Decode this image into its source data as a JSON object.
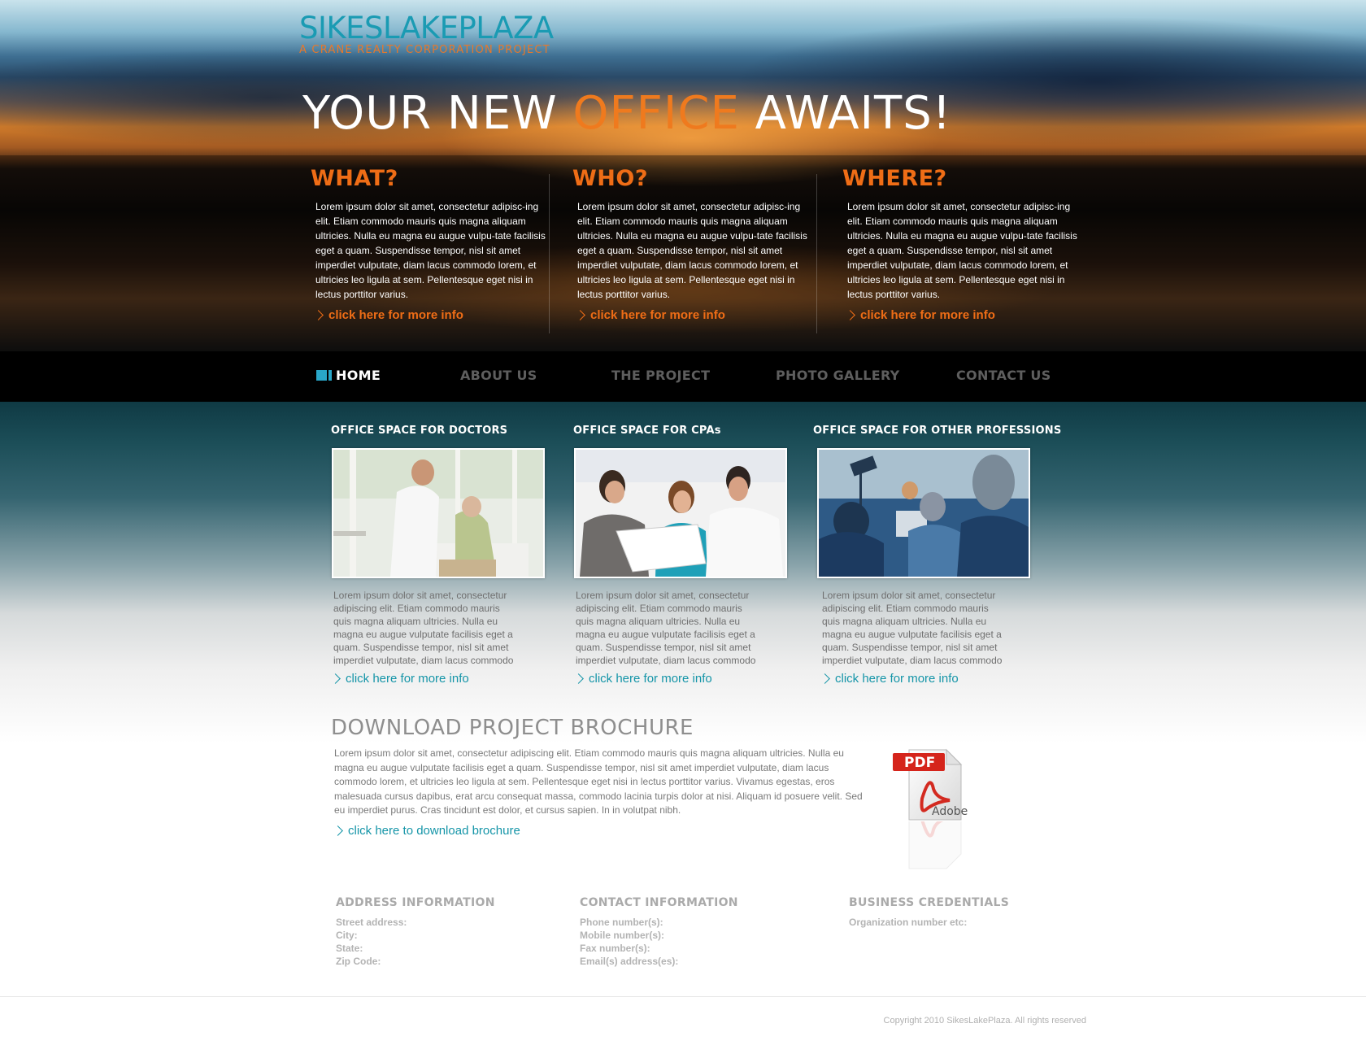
{
  "brand": {
    "name": "SIKESLAKEPLAZA",
    "tagline": "A CRANE REALTY CORPORATION PROJECT",
    "colors": {
      "teal": "#1a9bb3",
      "orange": "#ef6d16"
    }
  },
  "hero": {
    "headline_pre": "YOUR NEW ",
    "headline_accent": "OFFICE",
    "headline_post": " AWAITS!",
    "columns": [
      {
        "title": "WHAT?",
        "text": "Lorem ipsum dolor sit amet, consectetur adipisc-ing elit. Etiam commodo mauris quis magna aliquam ultricies. Nulla eu magna eu augue vulpu-tate facilisis eget a quam. Suspendisse tempor, nisl sit amet imperdiet vulputate, diam lacus commodo lorem, et ultricies leo ligula at sem. Pellentesque eget nisi in lectus porttitor varius.",
        "link": "click here for more info"
      },
      {
        "title": "WHO?",
        "text": "Lorem ipsum dolor sit amet, consectetur adipisc-ing elit. Etiam commodo mauris quis magna aliquam ultricies. Nulla eu magna eu augue vulpu-tate facilisis eget a quam. Suspendisse tempor, nisl sit amet imperdiet vulputate, diam lacus commodo lorem, et ultricies leo ligula at sem. Pellentesque eget nisi in lectus porttitor varius.",
        "link": "click here for more info"
      },
      {
        "title": "WHERE?",
        "text": "Lorem ipsum dolor sit amet, consectetur adipisc-ing elit. Etiam commodo mauris quis magna aliquam ultricies. Nulla eu magna eu augue vulpu-tate facilisis eget a quam. Suspendisse tempor, nisl sit amet imperdiet vulputate, diam lacus commodo lorem, et ultricies leo ligula at sem. Pellentesque eget nisi in lectus porttitor varius.",
        "link": "click here for more info"
      }
    ]
  },
  "nav": {
    "items": [
      {
        "label": "HOME",
        "active": true
      },
      {
        "label": "ABOUT US"
      },
      {
        "label": "THE PROJECT"
      },
      {
        "label": "PHOTO GALLERY"
      },
      {
        "label": "CONTACT US"
      }
    ]
  },
  "services": [
    {
      "title": "OFFICE SPACE FOR DOCTORS",
      "text": "Lorem ipsum dolor sit amet, consectetur adipiscing elit. Etiam commodo mauris quis magna aliquam ultricies. Nulla eu magna eu augue vulputate facilisis eget a quam. Suspendisse tempor, nisl sit amet imperdiet vulputate, diam lacus commodo",
      "link": "click here for more info"
    },
    {
      "title": "OFFICE SPACE FOR CPAs",
      "text": "Lorem ipsum dolor sit amet, consectetur adipiscing elit. Etiam commodo mauris quis magna aliquam ultricies. Nulla eu magna eu augue vulputate facilisis eget a quam. Suspendisse tempor, nisl sit amet imperdiet vulputate, diam lacus commodo",
      "link": "click here for more info"
    },
    {
      "title": "OFFICE SPACE FOR OTHER PROFESSIONS",
      "text": "Lorem ipsum dolor sit amet, consectetur adipiscing elit. Etiam commodo mauris quis magna aliquam ultricies. Nulla eu magna eu augue vulputate facilisis eget a quam. Suspendisse tempor, nisl sit amet imperdiet vulputate, diam lacus commodo",
      "link": "click here for more info"
    }
  ],
  "brochure": {
    "title": "DOWNLOAD PROJECT BROCHURE",
    "text": "Lorem ipsum dolor sit amet, consectetur adipiscing elit. Etiam commodo mauris quis magna aliquam ultricies. Nulla eu magna eu augue vulputate facilisis eget a quam. Suspendisse tempor, nisl sit amet imperdiet vulputate, diam lacus commodo lorem, et ultricies leo ligula at sem. Pellentesque eget nisi in lectus porttitor varius. Vivamus egestas, eros malesuada cursus dapibus, erat arcu consequat massa, commodo lacinia turpis dolor at nisi. Aliquam id posuere velit. Sed eu imperdiet purus. Cras tincidunt est dolor, et cursus sapien. In in volutpat nibh.",
    "link": "click here to download brochure",
    "pdf_label": "PDF",
    "pdf_brand": "Adobe"
  },
  "info": {
    "address": {
      "title": "ADDRESS INFORMATION",
      "lines": [
        "Street address:",
        "City:",
        "State:",
        "Zip Code:"
      ]
    },
    "contact": {
      "title": "CONTACT INFORMATION",
      "lines": [
        "Phone number(s):",
        "Mobile number(s):",
        "Fax number(s):",
        "Email(s) address(es):"
      ]
    },
    "credentials": {
      "title": "BUSINESS CREDENTIALS",
      "lines": [
        "Organization number etc:"
      ]
    }
  },
  "footer": {
    "copyright": "Copyright 2010 SikesLakePlaza. All rights reserved"
  }
}
